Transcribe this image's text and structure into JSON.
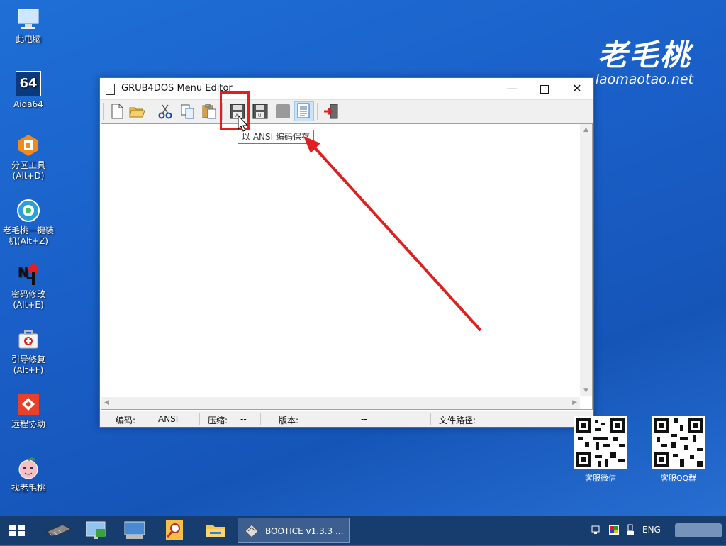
{
  "desktop": {
    "icons": [
      {
        "label1": "此电脑",
        "label2": ""
      },
      {
        "label1": "Aida64",
        "label2": ""
      },
      {
        "label1": "分区工具",
        "label2": "(Alt+D)"
      },
      {
        "label1": "老毛桃一键装",
        "label2": "机(Alt+Z)"
      },
      {
        "label1": "密码修改",
        "label2": "(Alt+E)"
      },
      {
        "label1": "引导修复",
        "label2": "(Alt+F)"
      },
      {
        "label1": "远程协助",
        "label2": ""
      },
      {
        "label1": "找老毛桃",
        "label2": ""
      }
    ],
    "aida_badge": "64"
  },
  "brand": {
    "name": "老毛桃",
    "url": "laomaotao.net"
  },
  "window": {
    "title": "GRUB4DOS Menu Editor",
    "tooltip": "以 ANSI 编码保存",
    "status": {
      "encoding_label": "编码:",
      "encoding_value": "ANSI",
      "compress_label": "压缩:",
      "compress_value": "--",
      "version_label": "版本:",
      "version_value": "--",
      "path_label": "文件路径:",
      "path_value": ""
    }
  },
  "qr": [
    {
      "label": "客服微信"
    },
    {
      "label": "客服QQ群"
    }
  ],
  "taskbar": {
    "active_task": "BOOTICE v1.3.3 ...",
    "lang": "ENG"
  },
  "colors": {
    "accent": "#1a73e8",
    "highlight": "#e02020",
    "taskbar": "#173c6e"
  }
}
